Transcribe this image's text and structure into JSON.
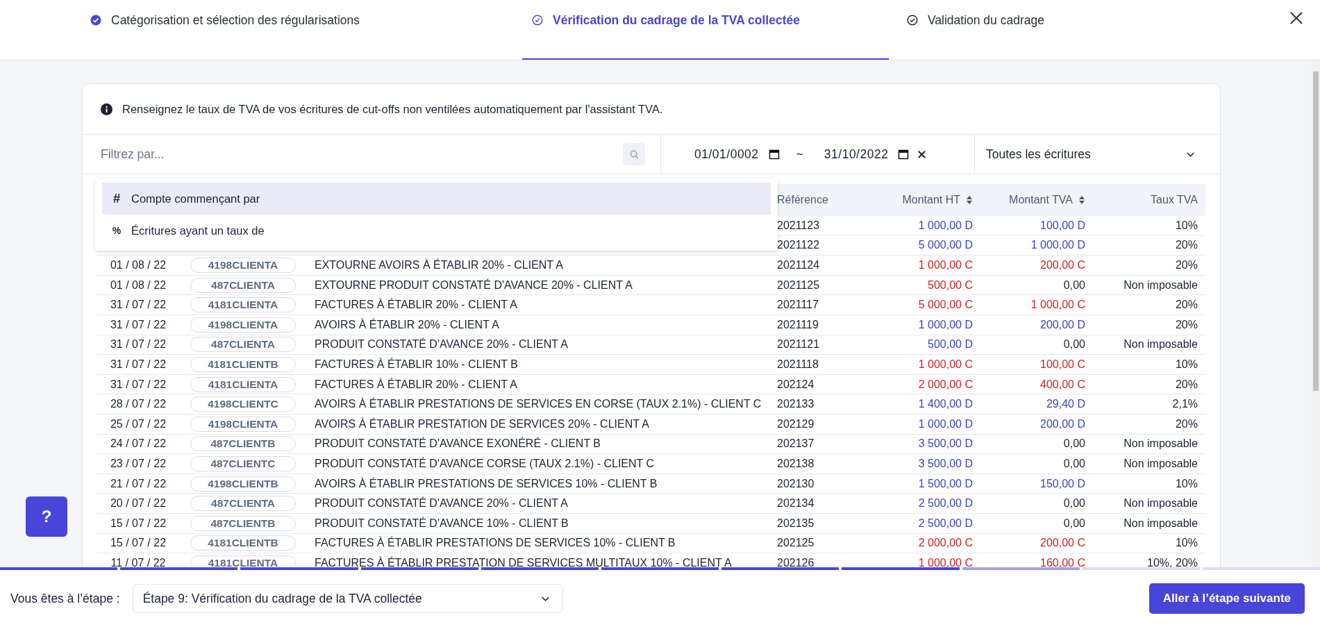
{
  "steps": [
    {
      "label": "Catégorisation et sélection des régularisations",
      "completed": true,
      "selected": false
    },
    {
      "label": "Vérification du cadrage de la TVA collectée",
      "completed": false,
      "selected": true
    },
    {
      "label": "Validation du cadrage",
      "completed": false,
      "selected": false
    }
  ],
  "info": "Renseignez le taux de TVA de vos écritures de cut-offs non ventilées automatiquement par l'assistant TVA.",
  "filter": {
    "placeholder": "Filtrez par...",
    "date_from": "01/01/0002",
    "separator": "~",
    "date_to": "31/10/2022",
    "scope": "Toutes les écritures"
  },
  "filter_menu": [
    {
      "symbol": "#",
      "label": "Compte commençant par",
      "selected": true
    },
    {
      "symbol": "%",
      "label": "Écritures ayant un taux de",
      "selected": false
    }
  ],
  "table": {
    "columns": [
      {
        "label": "Référence",
        "sortable": false
      },
      {
        "label": "Montant HT",
        "sortable": true
      },
      {
        "label": "Montant TVA",
        "sortable": true
      },
      {
        "label": "Taux TVA",
        "sortable": false
      }
    ],
    "rows": [
      {
        "reference": "2021123",
        "ht": {
          "text": "1 000,00 D",
          "kind": "debit"
        },
        "tva": {
          "text": "100,00 D",
          "kind": "debit"
        },
        "rate": "10%"
      },
      {
        "reference": "2021122",
        "ht": {
          "text": "5 000,00 D",
          "kind": "debit"
        },
        "tva": {
          "text": "1 000,00 D",
          "kind": "debit"
        },
        "rate": "20%"
      },
      {
        "date": "01 / 08 / 22",
        "account": "4198CLIENTA",
        "label": "EXTOURNE AVOIRS À ÉTABLIR 20% - CLIENT A",
        "reference": "2021124",
        "ht": {
          "text": "1 000,00 C",
          "kind": "credit"
        },
        "tva": {
          "text": "200,00 C",
          "kind": "credit"
        },
        "rate": "20%"
      },
      {
        "date": "01 / 08 / 22",
        "account": "487CLIENTA",
        "label": "EXTOURNE PRODUIT CONSTATÉ D'AVANCE 20% - CLIENT A",
        "reference": "2021125",
        "ht": {
          "text": "500,00 C",
          "kind": "credit"
        },
        "tva": {
          "text": "0,00",
          "kind": "zero"
        },
        "rate": "Non imposable"
      },
      {
        "date": "31 / 07 / 22",
        "account": "4181CLIENTA",
        "label": "FACTURES À ÉTABLIR 20% - CLIENT A",
        "reference": "2021117",
        "ht": {
          "text": "5 000,00 C",
          "kind": "credit"
        },
        "tva": {
          "text": "1 000,00 C",
          "kind": "credit"
        },
        "rate": "20%"
      },
      {
        "date": "31 / 07 / 22",
        "account": "4198CLIENTA",
        "label": "AVOIRS À ÉTABLIR 20% - CLIENT A",
        "reference": "2021119",
        "ht": {
          "text": "1 000,00 D",
          "kind": "debit"
        },
        "tva": {
          "text": "200,00 D",
          "kind": "debit"
        },
        "rate": "20%"
      },
      {
        "date": "31 / 07 / 22",
        "account": "487CLIENTA",
        "label": "PRODUIT CONSTATÉ D'AVANCE 20% - CLIENT A",
        "reference": "2021121",
        "ht": {
          "text": "500,00 D",
          "kind": "debit"
        },
        "tva": {
          "text": "0,00",
          "kind": "zero"
        },
        "rate": "Non imposable"
      },
      {
        "date": "31 / 07 / 22",
        "account": "4181CLIENTB",
        "label": "FACTURES À ÉTABLIR 10% - CLIENT B",
        "reference": "2021118",
        "ht": {
          "text": "1 000,00 C",
          "kind": "credit"
        },
        "tva": {
          "text": "100,00 C",
          "kind": "credit"
        },
        "rate": "10%"
      },
      {
        "date": "31 / 07 / 22",
        "account": "4181CLIENTA",
        "label": "FACTURES À ÉTABLIR 20% - CLIENT A",
        "reference": "202124",
        "ht": {
          "text": "2 000,00 C",
          "kind": "credit"
        },
        "tva": {
          "text": "400,00 C",
          "kind": "credit"
        },
        "rate": "20%"
      },
      {
        "date": "28 / 07 / 22",
        "account": "4198CLIENTC",
        "label": "AVOIRS À ÉTABLIR PRESTATIONS DE SERVICES EN CORSE (TAUX 2.1%) - CLIENT C",
        "reference": "202133",
        "ht": {
          "text": "1 400,00 D",
          "kind": "debit"
        },
        "tva": {
          "text": "29,40 D",
          "kind": "debit"
        },
        "rate": "2,1%"
      },
      {
        "date": "25 / 07 / 22",
        "account": "4198CLIENTA",
        "label": "AVOIRS À ÉTABLIR PRESTATION DE SERVICES 20% - CLIENT A",
        "reference": "202129",
        "ht": {
          "text": "1 000,00 D",
          "kind": "debit"
        },
        "tva": {
          "text": "200,00 D",
          "kind": "debit"
        },
        "rate": "20%"
      },
      {
        "date": "24 / 07 / 22",
        "account": "487CLIENTB",
        "label": "PRODUIT CONSTATÉ D'AVANCE EXONÉRÉ - CLIENT B",
        "reference": "202137",
        "ht": {
          "text": "3 500,00 D",
          "kind": "debit"
        },
        "tva": {
          "text": "0,00",
          "kind": "zero"
        },
        "rate": "Non imposable"
      },
      {
        "date": "23 / 07 / 22",
        "account": "487CLIENTC",
        "label": "PRODUIT CONSTATÉ D'AVANCE CORSE (TAUX 2.1%) - CLIENT C",
        "reference": "202138",
        "ht": {
          "text": "3 500,00 D",
          "kind": "debit"
        },
        "tva": {
          "text": "0,00",
          "kind": "zero"
        },
        "rate": "Non imposable"
      },
      {
        "date": "21 / 07 / 22",
        "account": "4198CLIENTB",
        "label": "AVOIRS À ÉTABLIR PRESTATIONS DE SERVICES 10% - CLIENT B",
        "reference": "202130",
        "ht": {
          "text": "1 500,00 D",
          "kind": "debit"
        },
        "tva": {
          "text": "150,00 D",
          "kind": "debit"
        },
        "rate": "10%"
      },
      {
        "date": "20 / 07 / 22",
        "account": "487CLIENTA",
        "label": "PRODUIT CONSTATÉ D'AVANCE 20% - CLIENT A",
        "reference": "202134",
        "ht": {
          "text": "2 500,00 D",
          "kind": "debit"
        },
        "tva": {
          "text": "0,00",
          "kind": "zero"
        },
        "rate": "Non imposable"
      },
      {
        "date": "15 / 07 / 22",
        "account": "487CLIENTB",
        "label": "PRODUIT CONSTATÉ D'AVANCE 10% - CLIENT B",
        "reference": "202135",
        "ht": {
          "text": "2 500,00 D",
          "kind": "debit"
        },
        "tva": {
          "text": "0,00",
          "kind": "zero"
        },
        "rate": "Non imposable"
      },
      {
        "date": "15 / 07 / 22",
        "account": "4181CLIENTB",
        "label": "FACTURES À ÉTABLIR PRESTATIONS DE SERVICES 10% - CLIENT B",
        "reference": "202125",
        "ht": {
          "text": "2 000,00 C",
          "kind": "credit"
        },
        "tva": {
          "text": "200,00 C",
          "kind": "credit"
        },
        "rate": "10%"
      },
      {
        "date": "11 / 07 / 22",
        "account": "4181CLIENTA",
        "label": "FACTURES À ÉTABLIR PRESTATION DE SERVICES MULTITAUX 10% - CLIENT A",
        "reference": "202126",
        "ht": {
          "text": "1 000,00 C",
          "kind": "credit"
        },
        "tva": {
          "text": "160,00 C",
          "kind": "credit"
        },
        "rate": "10%, 20%"
      }
    ]
  },
  "help": {
    "label": "?"
  },
  "progress": [
    {
      "kind": "done"
    },
    {
      "kind": "done"
    },
    {
      "kind": "done"
    },
    {
      "kind": "done"
    },
    {
      "kind": "done"
    },
    {
      "kind": "done"
    },
    {
      "kind": "done"
    },
    {
      "kind": "done"
    },
    {
      "kind": "current"
    },
    {
      "kind": "todo"
    },
    {
      "kind": "todo"
    }
  ],
  "footer": {
    "label": "Vous êtes à l’étape :",
    "step_select": "Étape 9: Vérification du cadrage de la TVA collectée",
    "next_button": "Aller à l’étape suivante"
  }
}
